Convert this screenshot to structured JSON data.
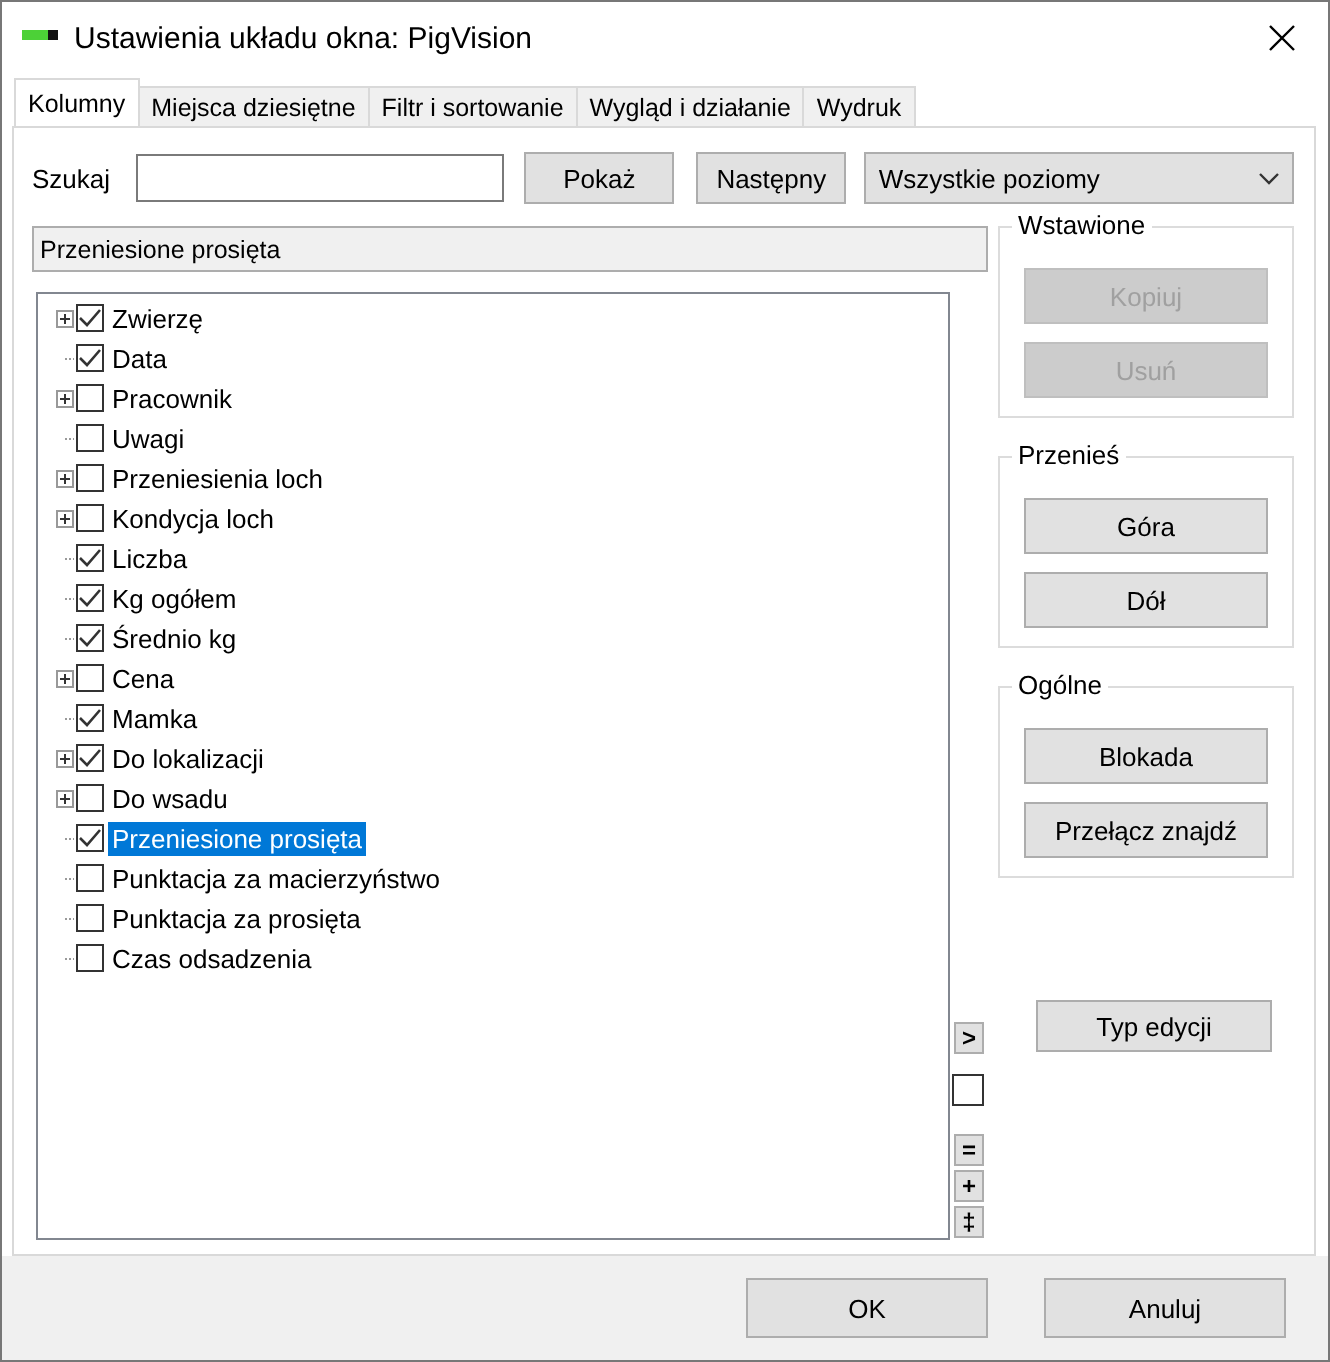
{
  "window": {
    "title": "Ustawienia układu okna: PigVision"
  },
  "tabs": [
    {
      "label": "Kolumny",
      "selected": true
    },
    {
      "label": "Miejsca dziesiętne",
      "selected": false
    },
    {
      "label": "Filtr i sortowanie",
      "selected": false
    },
    {
      "label": "Wygląd i działanie",
      "selected": false
    },
    {
      "label": "Wydruk",
      "selected": false
    }
  ],
  "search": {
    "label": "Szukaj",
    "show_button": "Pokaż",
    "next_button": "Następny",
    "level_dropdown": "Wszystkie poziomy"
  },
  "path_field": "Przeniesione prosięta",
  "tree": [
    {
      "label": "Zwierzę",
      "expandable": true,
      "checked": true,
      "selected": false
    },
    {
      "label": "Data",
      "expandable": false,
      "checked": true,
      "selected": false
    },
    {
      "label": "Pracownik",
      "expandable": true,
      "checked": false,
      "selected": false
    },
    {
      "label": "Uwagi",
      "expandable": false,
      "checked": false,
      "selected": false
    },
    {
      "label": "Przeniesienia loch",
      "expandable": true,
      "checked": false,
      "selected": false
    },
    {
      "label": "Kondycja loch",
      "expandable": true,
      "checked": false,
      "selected": false
    },
    {
      "label": "Liczba",
      "expandable": false,
      "checked": true,
      "selected": false
    },
    {
      "label": "Kg ogółem",
      "expandable": false,
      "checked": true,
      "selected": false
    },
    {
      "label": "Średnio kg",
      "expandable": false,
      "checked": true,
      "selected": false
    },
    {
      "label": "Cena",
      "expandable": true,
      "checked": false,
      "selected": false
    },
    {
      "label": "Mamka",
      "expandable": false,
      "checked": true,
      "selected": false
    },
    {
      "label": "Do lokalizacji",
      "expandable": true,
      "checked": true,
      "selected": false
    },
    {
      "label": "Do wsadu",
      "expandable": true,
      "checked": false,
      "selected": false
    },
    {
      "label": "Przeniesione prosięta",
      "expandable": false,
      "checked": true,
      "selected": true
    },
    {
      "label": "Punktacja za macierzyństwo",
      "expandable": false,
      "checked": false,
      "selected": false
    },
    {
      "label": "Punktacja za prosięta",
      "expandable": false,
      "checked": false,
      "selected": false
    },
    {
      "label": "Czas odsadzenia",
      "expandable": false,
      "checked": false,
      "selected": false
    }
  ],
  "side_controls": [
    {
      "kind": "button",
      "label": ">"
    },
    {
      "kind": "checkbox",
      "checked": false
    },
    {
      "kind": "button",
      "label": "="
    },
    {
      "kind": "button",
      "label": "+"
    },
    {
      "kind": "button",
      "label": "‡"
    }
  ],
  "groups": [
    {
      "title": "Wstawione",
      "buttons": [
        {
          "label": "Kopiuj",
          "disabled": true
        },
        {
          "label": "Usuń",
          "disabled": true
        }
      ]
    },
    {
      "title": "Przenieś",
      "buttons": [
        {
          "label": "Góra",
          "disabled": false
        },
        {
          "label": "Dół",
          "disabled": false
        }
      ]
    },
    {
      "title": "Ogólne",
      "buttons": [
        {
          "label": "Blokada",
          "disabled": false
        },
        {
          "label": "Przełącz znajdź",
          "disabled": false
        }
      ]
    }
  ],
  "edit_type_button": "Typ edycji",
  "footer_buttons": [
    "OK",
    "Anuluj"
  ]
}
